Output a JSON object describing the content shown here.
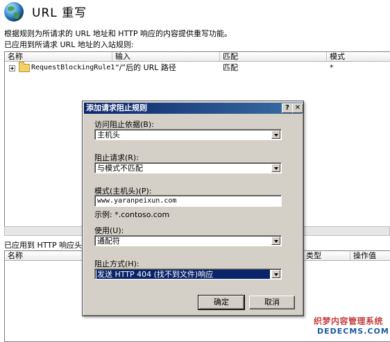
{
  "header": {
    "title": "URL 重写",
    "description": "根据规则为所请求的 URL 地址和 HTTP 响应的内容提供重写功能。",
    "inbound_caption": "已应用到所请求 URL 地址的入站规则:"
  },
  "inbound_list": {
    "columns": [
      "名称",
      "输入",
      "匹配",
      "模式"
    ],
    "rows": [
      {
        "name": "RequestBlockingRule1",
        "input": "“/”后的 URL 路径",
        "match": "匹配",
        "pattern": "*"
      }
    ]
  },
  "outbound": {
    "caption": "已应用到 HTTP 响应头或",
    "columns": [
      "名称",
      "类型",
      "操作值"
    ]
  },
  "dialog": {
    "title": "添加请求阻止规则",
    "help_label": "?",
    "close_label": "✕",
    "access_label": "访问阻止依据(B):",
    "access_value": "主机头",
    "block_label": "阻止请求(R):",
    "block_value": "与模式不匹配",
    "pattern_label": "模式(主机头)(P):",
    "pattern_value": "www.yaranpeixun.com",
    "example_text": "示例: *.contoso.com",
    "using_label": "使用(U):",
    "using_value": "通配符",
    "blockway_label": "阻止方式(H):",
    "blockway_value": "发送 HTTP 404 (找不到文件)响应",
    "ok_label": "确定",
    "cancel_label": "取消"
  },
  "watermark": {
    "line1": "织梦内容管理系统",
    "line2": "DEDECMS.COM"
  },
  "icons": {
    "globe": "globe-icon",
    "folder": "folder-icon",
    "expander": "tree-expander-icon",
    "dropdown": "dropdown-arrow-icon"
  },
  "colors": {
    "titlebar": "#0a246a",
    "dialog_face": "#d4d0c8",
    "selection": "#0a246a"
  }
}
